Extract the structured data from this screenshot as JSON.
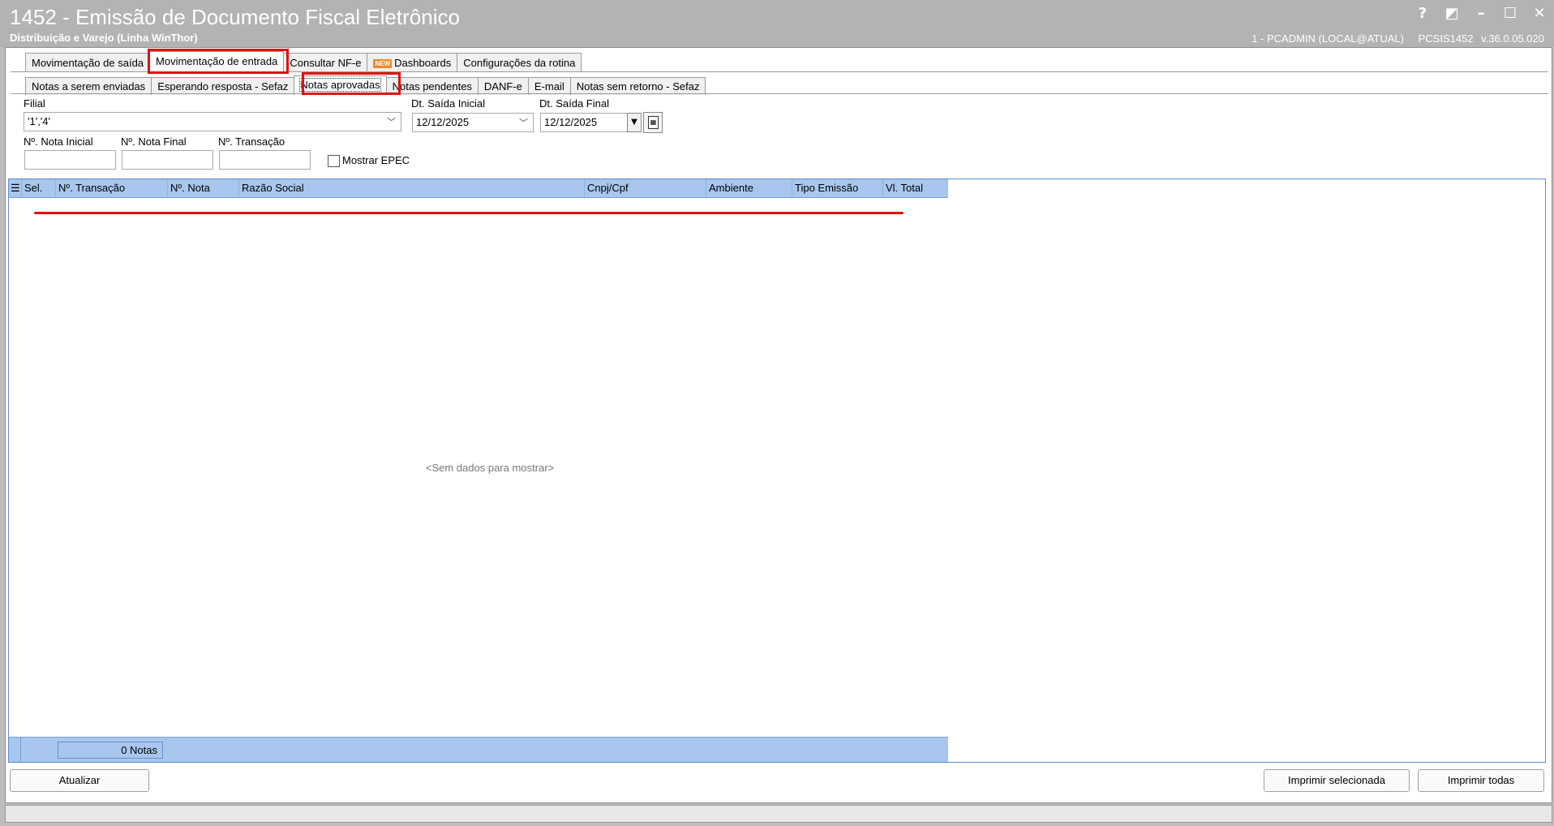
{
  "window": {
    "title": "1452 - Emissão de Documento Fiscal Eletrônico",
    "subtitle": "Distribuição e Varejo (Linha WinThor)",
    "user_info": "1 - PCADMIN (LOCAL@ATUAL)",
    "routine": "PCSIS1452",
    "version": "v.36.0.05.020",
    "buttons": {
      "help": "?",
      "restore": "◩",
      "minimize": "–",
      "maximize": "☐",
      "close": "✕"
    }
  },
  "main_tabs": [
    {
      "label": "Movimentação de saída",
      "active": false
    },
    {
      "label": "Movimentação de entrada",
      "active": true
    },
    {
      "label": "Consultar NF-e",
      "active": false
    },
    {
      "label": "Dashboards",
      "active": false,
      "badge": "NEW"
    },
    {
      "label": "Configurações da rotina",
      "active": false
    }
  ],
  "sub_tabs": [
    {
      "label": "Notas a serem enviadas",
      "active": false
    },
    {
      "label": "Esperando resposta - Sefaz",
      "active": false
    },
    {
      "label": "Notas aprovadas",
      "active": true
    },
    {
      "label": "Notas pendentes",
      "active": false
    },
    {
      "label": "DANF-e",
      "active": false
    },
    {
      "label": "E-mail",
      "active": false
    },
    {
      "label": "Notas sem retorno - Sefaz",
      "active": false
    }
  ],
  "filters": {
    "filial": {
      "label": "Filial",
      "value": "'1','4'"
    },
    "dt_saida_inicial": {
      "label": "Dt. Saída Inicial",
      "value": "12/12/2025"
    },
    "dt_saida_final": {
      "label": "Dt. Saída Final",
      "value": "12/12/2025"
    },
    "nota_inicial": {
      "label": "Nº. Nota Inicial",
      "value": ""
    },
    "nota_final": {
      "label": "Nº. Nota Final",
      "value": ""
    },
    "transacao": {
      "label": "Nº. Transação",
      "value": ""
    },
    "mostrar_epec": {
      "label": "Mostrar EPEC",
      "checked": false
    }
  },
  "grid": {
    "columns": [
      "Sel.",
      "Nº. Transação",
      "Nº. Nota",
      "Razão Social",
      "Cnpj/Cpf",
      "Ambiente",
      "Tipo Emissão",
      "Vl. Total"
    ],
    "rows": [],
    "empty_message": "<Sem dados para mostrar>",
    "footer_count": "0 Notas"
  },
  "actions": {
    "atualizar": "Atualizar",
    "imprimir_selecionada": "Imprimir selecionada",
    "imprimir_todas": "Imprimir todas"
  },
  "colors": {
    "grid_header": "#a9c6ee",
    "highlight": "#e01010",
    "titlebar": "#b3b3b3"
  }
}
